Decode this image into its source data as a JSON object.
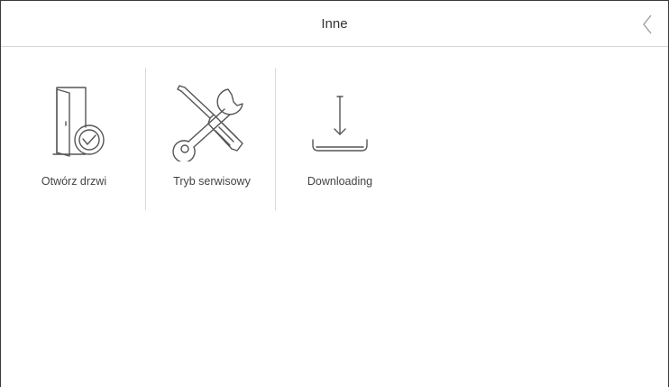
{
  "header": {
    "title": "Inne",
    "back_icon": "chevron-left-icon"
  },
  "tiles": [
    {
      "label": "Otwórz drzwi",
      "icon": "door-check-icon"
    },
    {
      "label": "Tryb serwisowy",
      "icon": "service-tools-icon"
    },
    {
      "label": "Downloading",
      "icon": "download-tray-icon"
    }
  ],
  "colors": {
    "icon_stroke": "#555555",
    "divider": "#d9d9d9",
    "header_border": "#d6d6d6",
    "text": "#444444"
  }
}
